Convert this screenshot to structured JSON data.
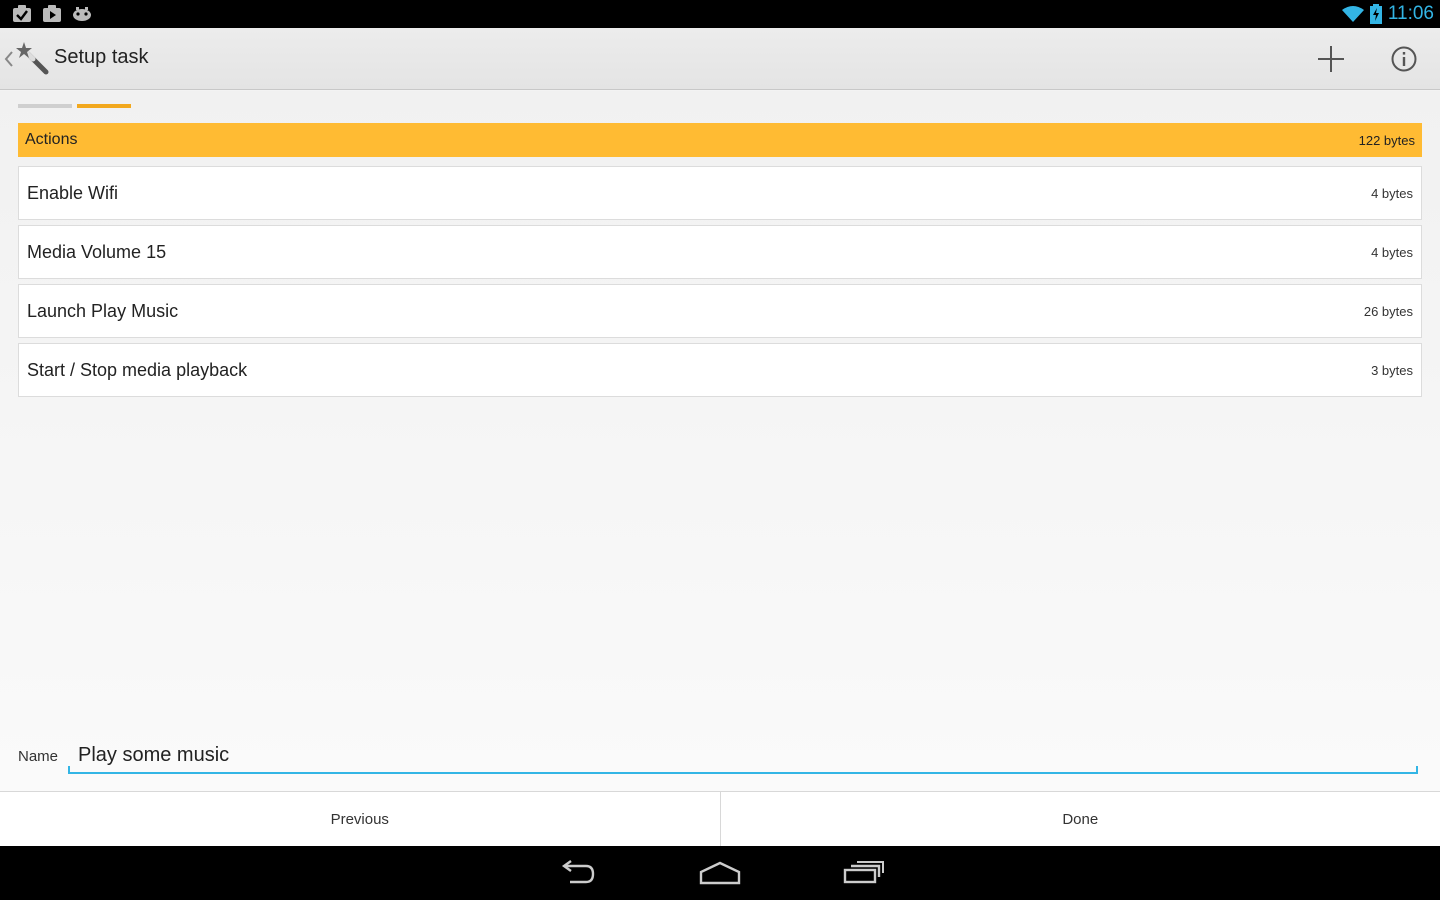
{
  "status_bar": {
    "time": "11:06",
    "accent_color": "#33b5e5",
    "notification_icons": [
      "task-check-icon",
      "play-store-icon",
      "gamepad-icon"
    ],
    "system_icons": [
      "wifi-icon",
      "battery-charging-icon"
    ]
  },
  "action_bar": {
    "title": "Setup task",
    "icons": [
      "up-caret-icon",
      "magic-wand-icon",
      "plus-icon",
      "info-icon"
    ]
  },
  "steps": {
    "total": 2,
    "active_index": 1,
    "active_color": "#f2a81d"
  },
  "section": {
    "title": "Actions",
    "size": "122 bytes",
    "color": "#ffbb33"
  },
  "actions": [
    {
      "label": "Enable Wifi",
      "size": "4 bytes"
    },
    {
      "label": "Media Volume 15",
      "size": "4 bytes"
    },
    {
      "label": "Launch Play Music",
      "size": "26 bytes"
    },
    {
      "label": "Start / Stop media playback",
      "size": "3 bytes"
    }
  ],
  "name_field": {
    "label": "Name",
    "value": "Play some music"
  },
  "buttons": {
    "previous": "Previous",
    "done": "Done"
  },
  "nav_bar": {
    "icons": [
      "back-icon",
      "home-icon",
      "recents-icon"
    ]
  }
}
